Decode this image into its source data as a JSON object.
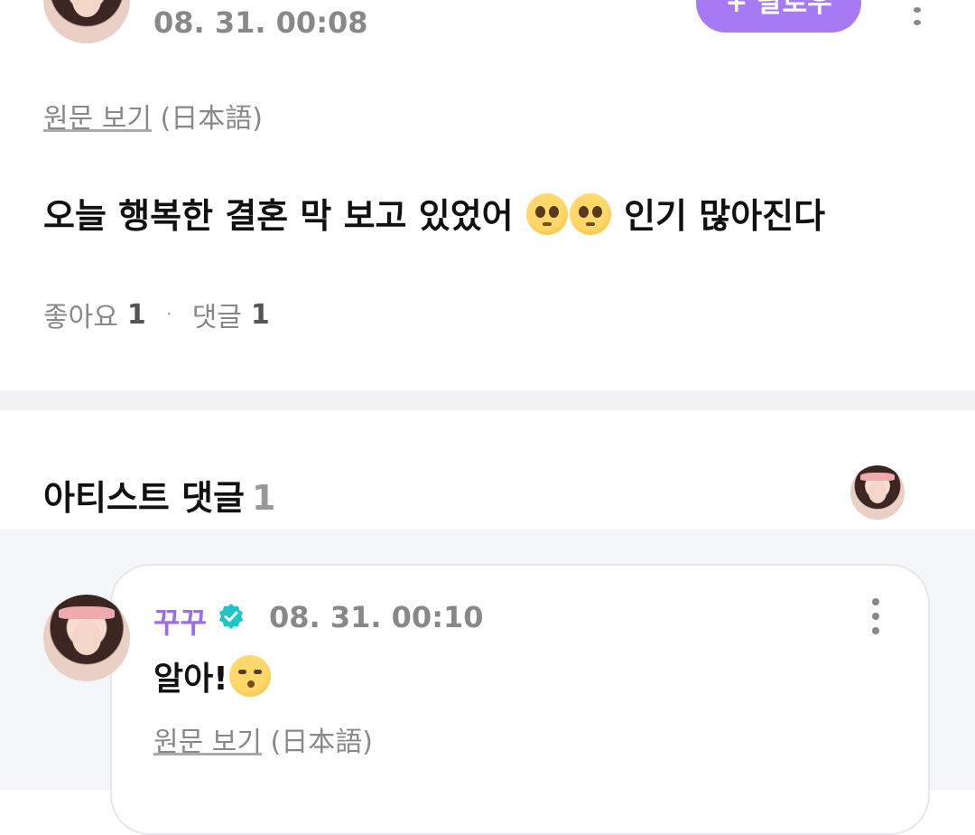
{
  "post": {
    "date": "08. 31. 00:08",
    "follow_label": "+ 팔로우",
    "translate_link": "원문 보기",
    "translate_lang": "(日本語)",
    "body_before": "오늘 행복한 결혼 막 보고 있었어 ",
    "body_after": " 인기 많아진다",
    "likes_label": "좋아요",
    "likes_count": "1",
    "comments_label": "댓글",
    "comments_count": "1"
  },
  "artist_comments": {
    "heading": "아티스트 댓글",
    "count": "1"
  },
  "comment": {
    "author": "꾸꾸",
    "date": "08. 31. 00:10",
    "text": "알아!",
    "translate_link": "원문 보기",
    "translate_lang": "(日本語)"
  },
  "colors": {
    "accent": "#a779f3",
    "verified": "#1ec5c8",
    "muted_text": "#888888"
  },
  "icons": {
    "verified": "verified-badge-icon",
    "more": "more-vertical-icon",
    "pleading": "pleading-face-emoji",
    "kiss": "kissing-face-emoji"
  }
}
